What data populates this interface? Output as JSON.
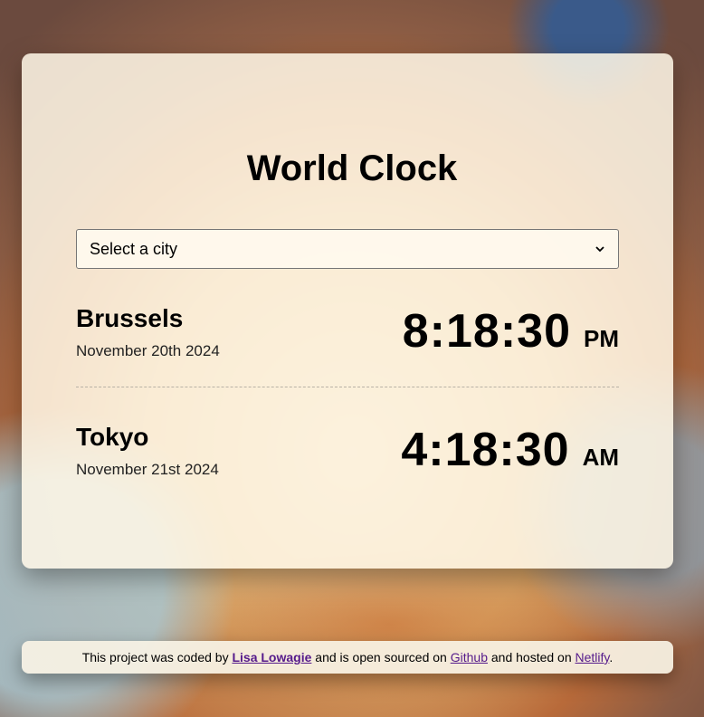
{
  "app": {
    "title": "World Clock"
  },
  "select": {
    "selected": "Select a city"
  },
  "cities": [
    {
      "name": "Brussels",
      "date": "November 20th 2024",
      "time": "8:18:30",
      "ampm": "PM"
    },
    {
      "name": "Tokyo",
      "date": "November 21st 2024",
      "time": "4:18:30",
      "ampm": "AM"
    }
  ],
  "footer": {
    "text1": "This project was coded by ",
    "author": "Lisa Lowagie",
    "text2": " and is open sourced on ",
    "github": "Github",
    "text3": " and hosted on ",
    "netlify": "Netlify",
    "text4": "."
  },
  "colors": {
    "card_bg": "#fff8e8",
    "text": "#000000",
    "link": "#551a8b"
  }
}
